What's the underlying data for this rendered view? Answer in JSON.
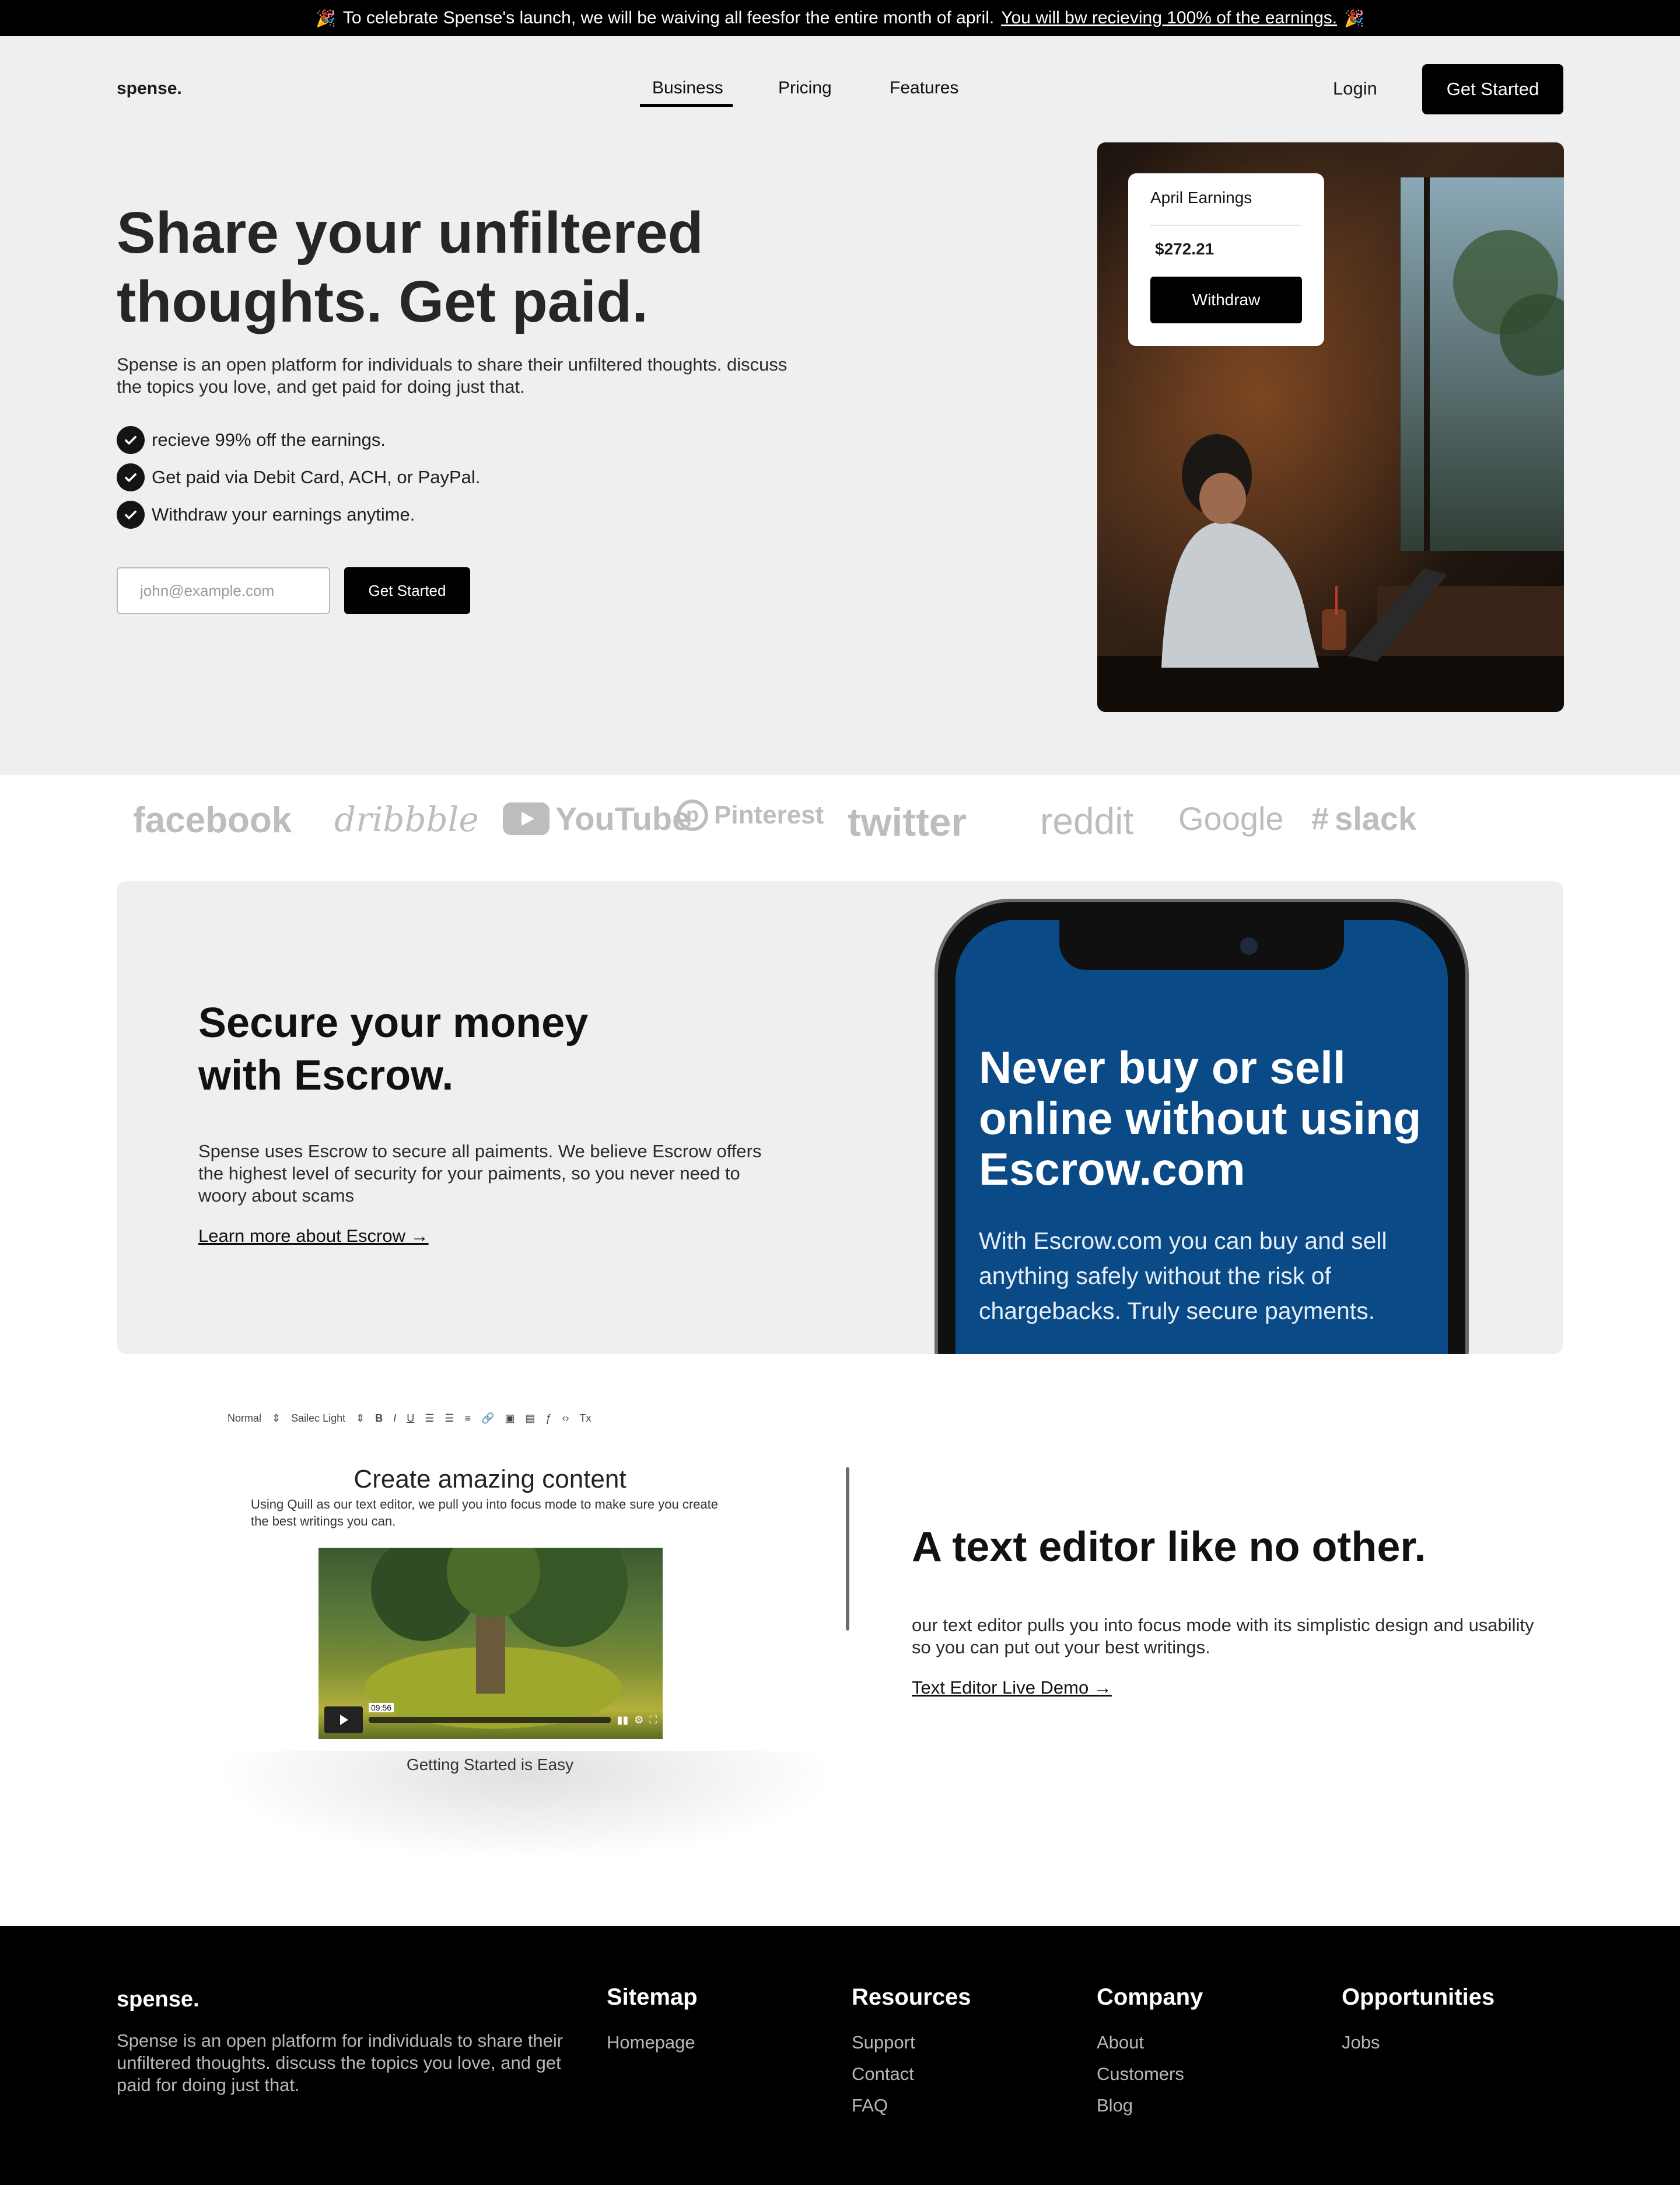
{
  "announcement": {
    "text": "To celebrate Spense's launch, we will be waiving all feesfor the entire month of april.",
    "link": "You will bw recieving 100% of the earnings."
  },
  "nav": {
    "logo": "spense.",
    "links": [
      "Business",
      "Pricing",
      "Features"
    ],
    "active": "Business",
    "login": "Login",
    "cta": "Get Started"
  },
  "hero": {
    "title": "Share your unfiltered thoughts. Get paid.",
    "description": "Spense is an open platform for individuals to share their unfiltered thoughts. discuss the topics you love, and get paid for doing just that.",
    "checklist": [
      "recieve 99% off the earnings.",
      "Get paid via Debit Card, ACH, or PayPal.",
      "Withdraw your earnings anytime."
    ],
    "email_placeholder": "john@example.com",
    "cta": "Get Started"
  },
  "earnings_card": {
    "title": "April Earnings",
    "amount": "$272.21",
    "button": "Withdraw"
  },
  "logos": [
    "facebook",
    "dribbble",
    "YouTube",
    "Pinterest",
    "twitter",
    "reddit",
    "Google",
    "slack"
  ],
  "escrow": {
    "title": "Secure your money with Escrow.",
    "description": "Spense uses Escrow to secure all paiments. We believe Escrow offers the highest level of security for your paiments, so you never need to woory about scams",
    "link": "Learn more about Escrow →",
    "phone_headline": "Never buy or sell online without using Escrow.com",
    "phone_sub": "With Escrow.com you can buy and sell anything safely without the risk of chargebacks. Truly secure payments."
  },
  "editor": {
    "toolbar": [
      "Normal",
      "Sailec Light",
      "B",
      "I",
      "U"
    ],
    "title": "Create amazing content",
    "subtitle": "Using Quill as our text editor, we pull you into focus mode to make sure you create the best writings you can.",
    "video_time": "09:56",
    "caption": "Getting Started is Easy"
  },
  "text_editor": {
    "title": "A text editor like no other.",
    "description": "our text editor pulls you into focus mode with its simplistic design and usability so you can put out your best writings.",
    "link": "Text Editor Live Demo →"
  },
  "footer": {
    "logo": "spense.",
    "description": "Spense is an open platform for individuals to share their unfiltered thoughts. discuss the topics you love, and get paid for doing just that.",
    "columns": [
      {
        "title": "Sitemap",
        "items": [
          "Homepage"
        ]
      },
      {
        "title": "Resources",
        "items": [
          "Support",
          "Contact",
          "FAQ"
        ]
      },
      {
        "title": "Company",
        "items": [
          "About",
          "Customers",
          "Blog"
        ]
      },
      {
        "title": "Opportunities",
        "items": [
          "Jobs"
        ]
      }
    ]
  }
}
